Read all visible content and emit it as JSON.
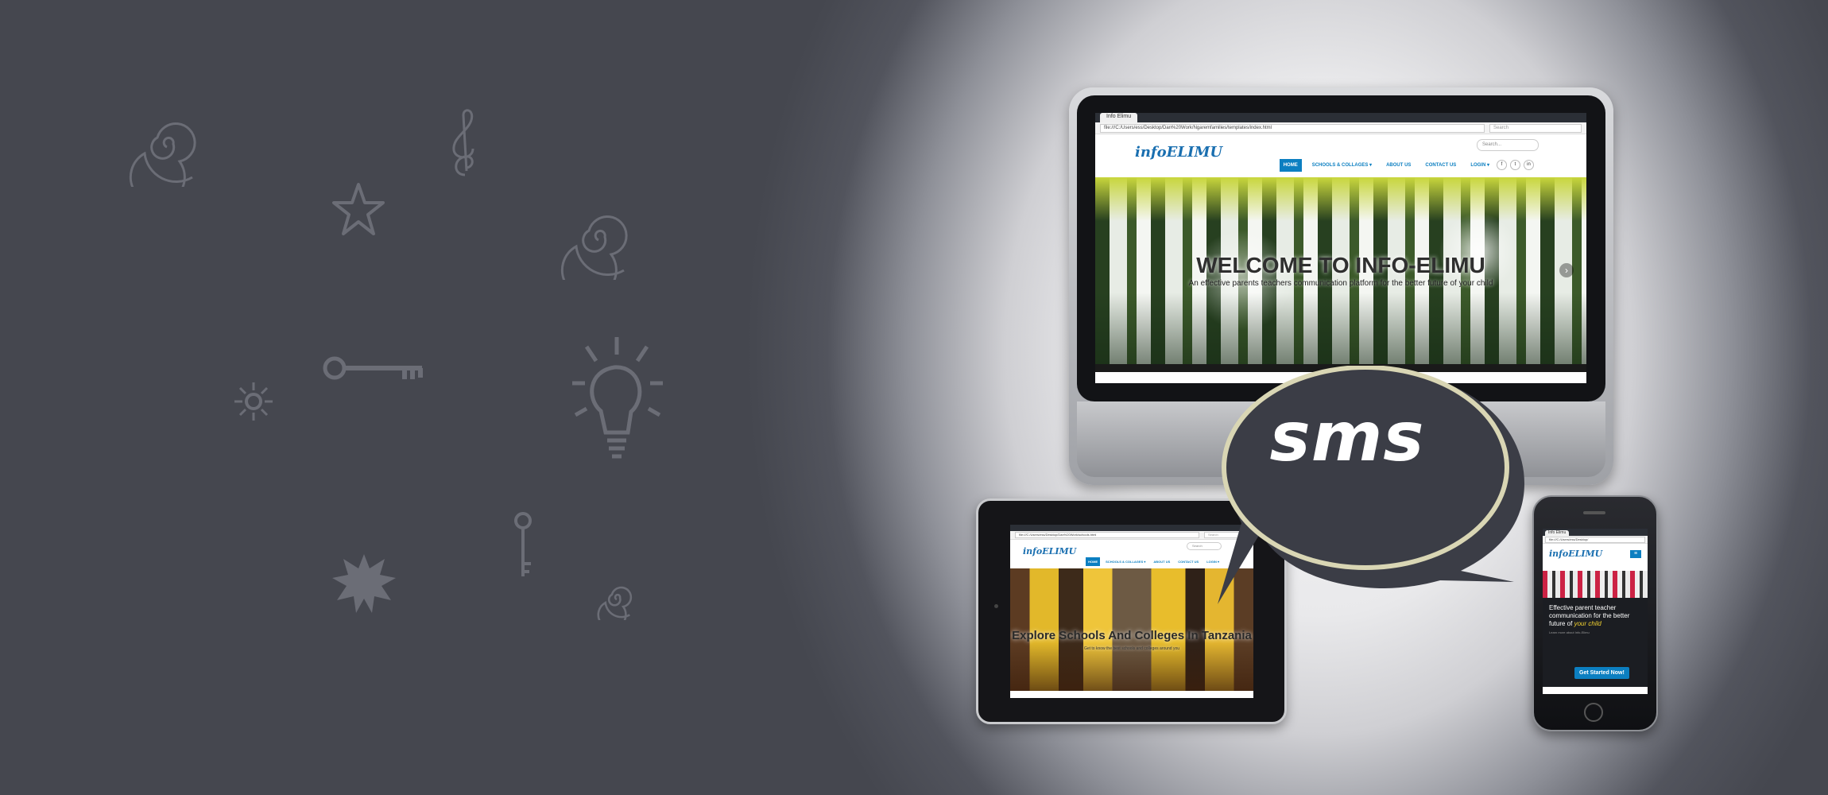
{
  "doodles": [
    "spiral-icon",
    "music-note-icon",
    "star-icon",
    "spiral-icon",
    "key-icon",
    "sun-icon",
    "lightbulb-icon",
    "key-icon",
    "starburst-icon",
    "spiral-icon"
  ],
  "sms_bubble": {
    "label": "sms"
  },
  "monitor": {
    "browser": {
      "tab_title": "Info Elimu",
      "url": "file:///C:/Users/ess/Desktop/Dan%20Work/Ngaremfamilies/templates/index.html",
      "search_placeholder": "Search"
    },
    "site": {
      "logo": "infoELIMU",
      "search_placeholder": "Search...",
      "nav": [
        "HOME",
        "SCHOOLS & COLLAGES ▾",
        "ABOUT US",
        "CONTACT US",
        "LOGIN ▾"
      ],
      "social": [
        "f",
        "t",
        "in"
      ],
      "hero_title": "WELCOME TO INFO-ELIMU",
      "hero_subtitle": "An effective parents teachers communication platform for the better future of your child",
      "next_arrow": "›"
    }
  },
  "tablet": {
    "browser": {
      "url": "file:///C:/Users/ess/Desktop/Dan%20Work/schools.html",
      "search_placeholder": "Search"
    },
    "site": {
      "logo": "infoELIMU",
      "search_placeholder": "Search",
      "nav": [
        "HOME",
        "SCHOOLS & COLLAGES ▾",
        "ABOUT US",
        "CONTACT US",
        "LOGIN ▾"
      ],
      "hero_title": "Explore Schools And Colleges In Tanzania",
      "hero_subtitle": "Get to know the best schools and colleges around you"
    }
  },
  "phone": {
    "browser": {
      "tab_title": "Info Elimu",
      "url": "file:///C:/Users/ess/Desktop/"
    },
    "site": {
      "logo": "infoELIMU",
      "menu_icon": "≡",
      "text_main": "Effective parent teacher communication for the better future of",
      "text_highlight": "your child",
      "text_small": "Learn more about Info-Elimu",
      "cta": "Get Started Now!"
    }
  },
  "colors": {
    "brand": "#0c7fc1",
    "bubble": "#3b3d46",
    "background_dark": "#45474f"
  }
}
